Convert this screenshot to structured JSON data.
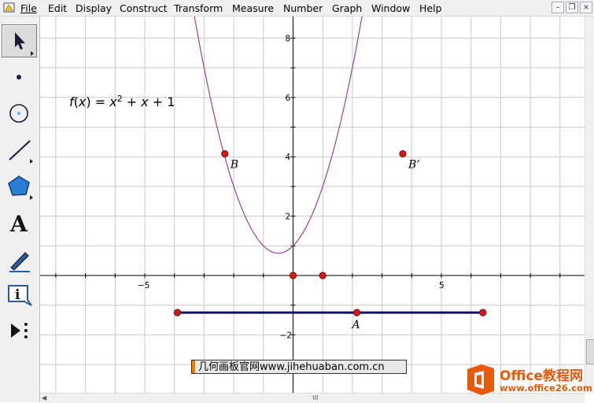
{
  "menu": {
    "file": "File",
    "edit": "Edit",
    "display": "Display",
    "construct": "Construct",
    "transform": "Transform",
    "measure": "Measure",
    "number": "Number",
    "graph": "Graph",
    "window": "Window",
    "help": "Help"
  },
  "tools": [
    "arrow-select-tool-icon",
    "point-tool-icon",
    "compass-tool-icon",
    "straightedge-tool-icon",
    "polygon-tool-icon",
    "text-tool-icon",
    "marker-tool-icon",
    "information-tool-icon",
    "custom-tool-icon"
  ],
  "tool_text_label": "A",
  "graph": {
    "function_label": {
      "f": "f",
      "open": "(",
      "x1": "x",
      "close": ")",
      "eq": " = ",
      "x2": "x",
      "exp": "2",
      "rest1": " + ",
      "x3": "x",
      "rest2": " + 1"
    },
    "x_ticks": [
      "−5",
      "5"
    ],
    "y_ticks": [
      "8",
      "6",
      "4",
      "2",
      "−2"
    ],
    "labels": {
      "B": "B",
      "B_prime": "B’",
      "A": "A"
    },
    "colors": {
      "curve": "#9a3fa5",
      "segment": "#0f0f6e",
      "point": "#d01a1a",
      "grid": "#c8c8c8",
      "axis": "#000000"
    },
    "points": {
      "B": [
        -2.3,
        4.1
      ],
      "B_prime": [
        3.7,
        4.1
      ],
      "origin": [
        0,
        0
      ],
      "unit": [
        1,
        0
      ],
      "seg_left": [
        -3.9,
        -1.25
      ],
      "seg_right": [
        6.4,
        -1.25
      ],
      "A": [
        2.15,
        -1.25
      ]
    }
  },
  "watermark": "几何画板官网www.jihehuaban.com.cn",
  "office": {
    "title": "Office教程网",
    "url": "www.office26.com"
  },
  "scroll": {
    "h_grip": "III"
  }
}
